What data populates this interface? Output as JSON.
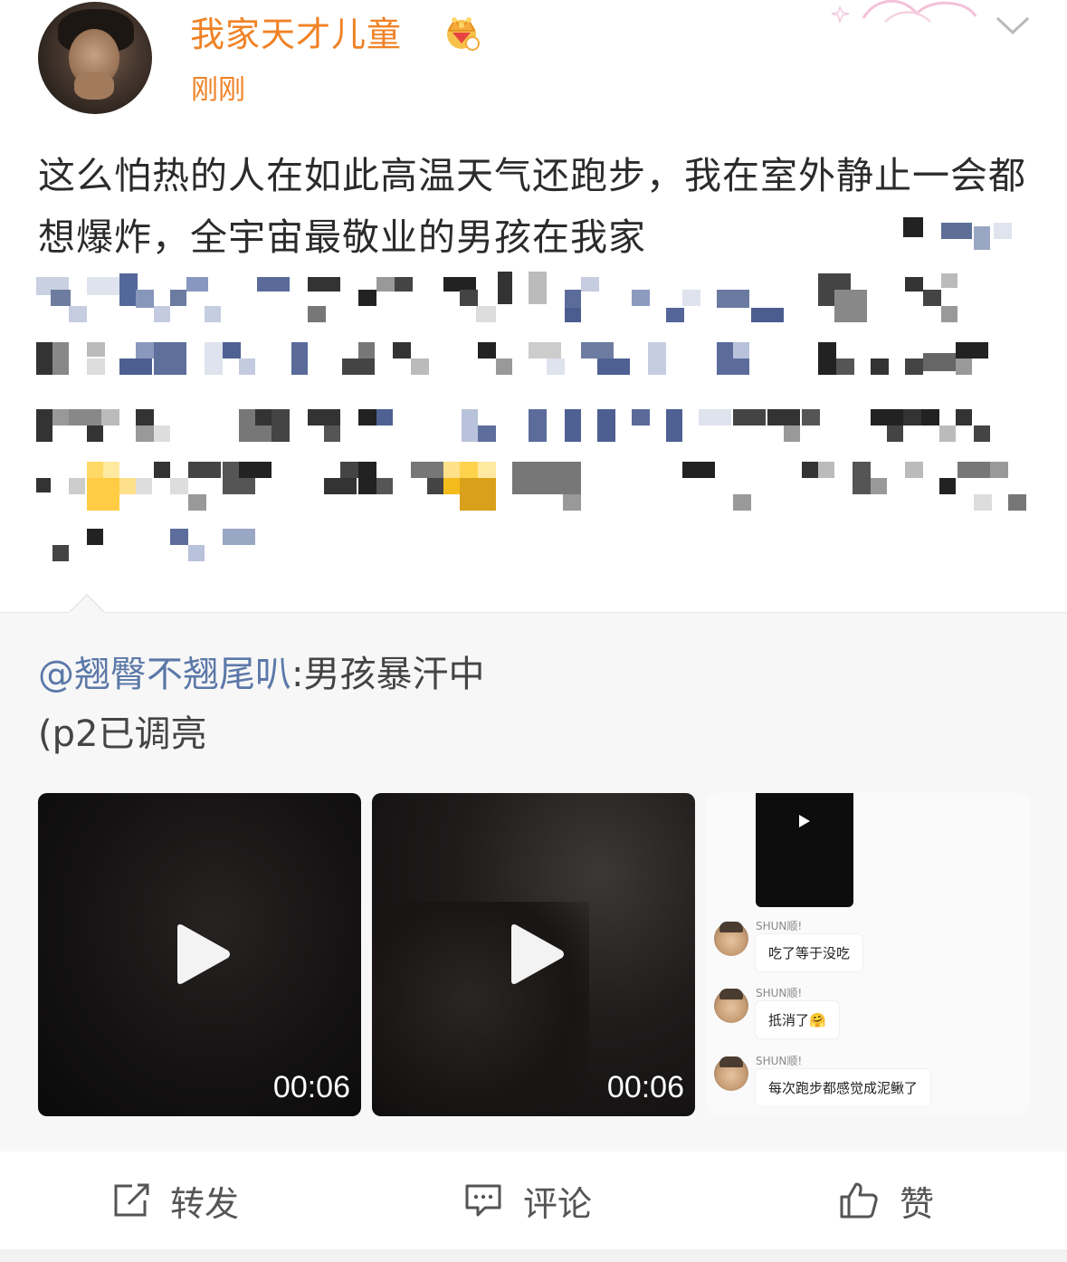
{
  "post": {
    "username": "我家天才儿童",
    "timeago": "刚刚",
    "text": "这么怕热的人在如此高温天气还跑步，我在室外静止一会都想爆炸，全宇宙最敬业的男孩在我家"
  },
  "repost": {
    "user": "@翘臀不翘尾叭",
    "text_after_user": ":男孩暴汗中",
    "line2": "(p2已调亮"
  },
  "media": [
    {
      "type": "video",
      "duration": "00:06"
    },
    {
      "type": "video",
      "duration": "00:06"
    },
    {
      "type": "chat-screenshot",
      "messages": [
        {
          "name": "SHUN顺!",
          "text": "吃了等于没吃"
        },
        {
          "name": "SHUN顺!",
          "text": "抵消了🤗"
        },
        {
          "name": "SHUN顺!",
          "text": "每次跑步都感觉成泥鳅了"
        }
      ]
    }
  ],
  "actions": {
    "repost_label": "转发",
    "comment_label": "评论",
    "like_label": "赞"
  },
  "icons": [
    "crown-badge-icon",
    "chevron-down-icon",
    "play-icon",
    "share-icon",
    "comment-icon",
    "thumbs-up-icon"
  ],
  "colors": {
    "username": "#f08225",
    "mention": "#5b78a8",
    "repost_bg": "#f7f7f7"
  }
}
